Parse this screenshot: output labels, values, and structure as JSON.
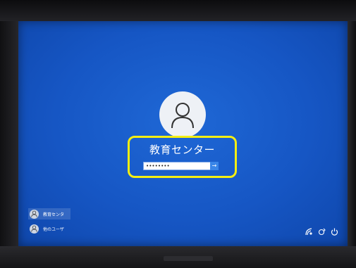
{
  "login": {
    "username": "教育センター",
    "password_masked": "••••••••",
    "submit_glyph": "→"
  },
  "user_list": [
    {
      "label": "教育センタ",
      "active": true
    },
    {
      "label": "他のユーザ",
      "active": false
    }
  ],
  "tray_icons": [
    "accessibility-icon",
    "network-icon",
    "power-icon"
  ],
  "colors": {
    "background": "#1656c4",
    "highlight": "#f4ef12",
    "bezel": "#1c1c1e"
  }
}
